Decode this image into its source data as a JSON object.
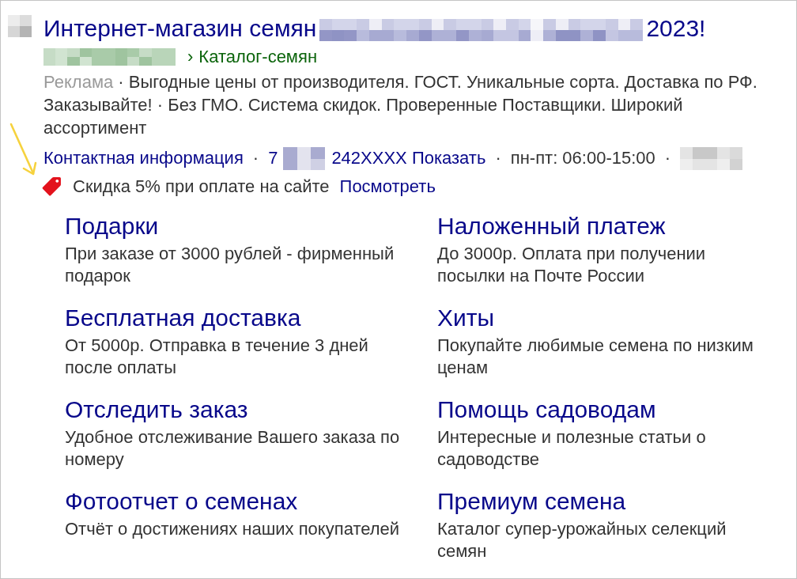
{
  "ad": {
    "title_start": "Интернет-магазин семян",
    "title_end": "2023!",
    "breadcrumb_separator": "›",
    "breadcrumb": "Каталог-семян",
    "ad_label": "Реклама",
    "description": "· Выгодные цены от производителя. ГОСТ. Уникальные сорта. Доставка по РФ. Заказывайте! · Без ГМО. Система скидок. Проверенные Поставщики. Широкий ассортимент",
    "contacts": [
      {
        "kind": "link",
        "text": "Контактная информация"
      },
      {
        "kind": "separator",
        "text": "·"
      },
      {
        "kind": "link",
        "text": "7"
      },
      {
        "kind": "redacted"
      },
      {
        "kind": "link",
        "text": "242XXXX Показать"
      },
      {
        "kind": "separator",
        "text": "·"
      },
      {
        "kind": "text",
        "text": "пн-пт: 06:00-15:00"
      },
      {
        "kind": "separator",
        "text": "·"
      },
      {
        "kind": "redacted"
      }
    ],
    "promo": {
      "text": "Скидка 5% при оплате на сайте",
      "link": "Посмотреть"
    },
    "sitelinks": [
      {
        "title": "Подарки",
        "description": "При заказе от 3000 рублей - фирменный подарок"
      },
      {
        "title": "Наложенный платеж",
        "description": "До 3000р. Оплата при получении посылки на Почте России"
      },
      {
        "title": "Бесплатная доставка",
        "description": "От 5000р. Отправка в течение 3 дней после оплаты"
      },
      {
        "title": "Хиты",
        "description": "Покупайте любимые семена по низким ценам"
      },
      {
        "title": "Отследить заказ",
        "description": "Удобное отслеживание Вашего заказа по номеру"
      },
      {
        "title": "Помощь садоводам",
        "description": "Интересные и полезные статьи о садоводстве"
      },
      {
        "title": "Фотоотчет о семенах",
        "description": "Отчёт о достижениях наших покупателей"
      },
      {
        "title": "Премиум семена",
        "description": "Каталог супер-урожайных селекций семян"
      }
    ]
  }
}
